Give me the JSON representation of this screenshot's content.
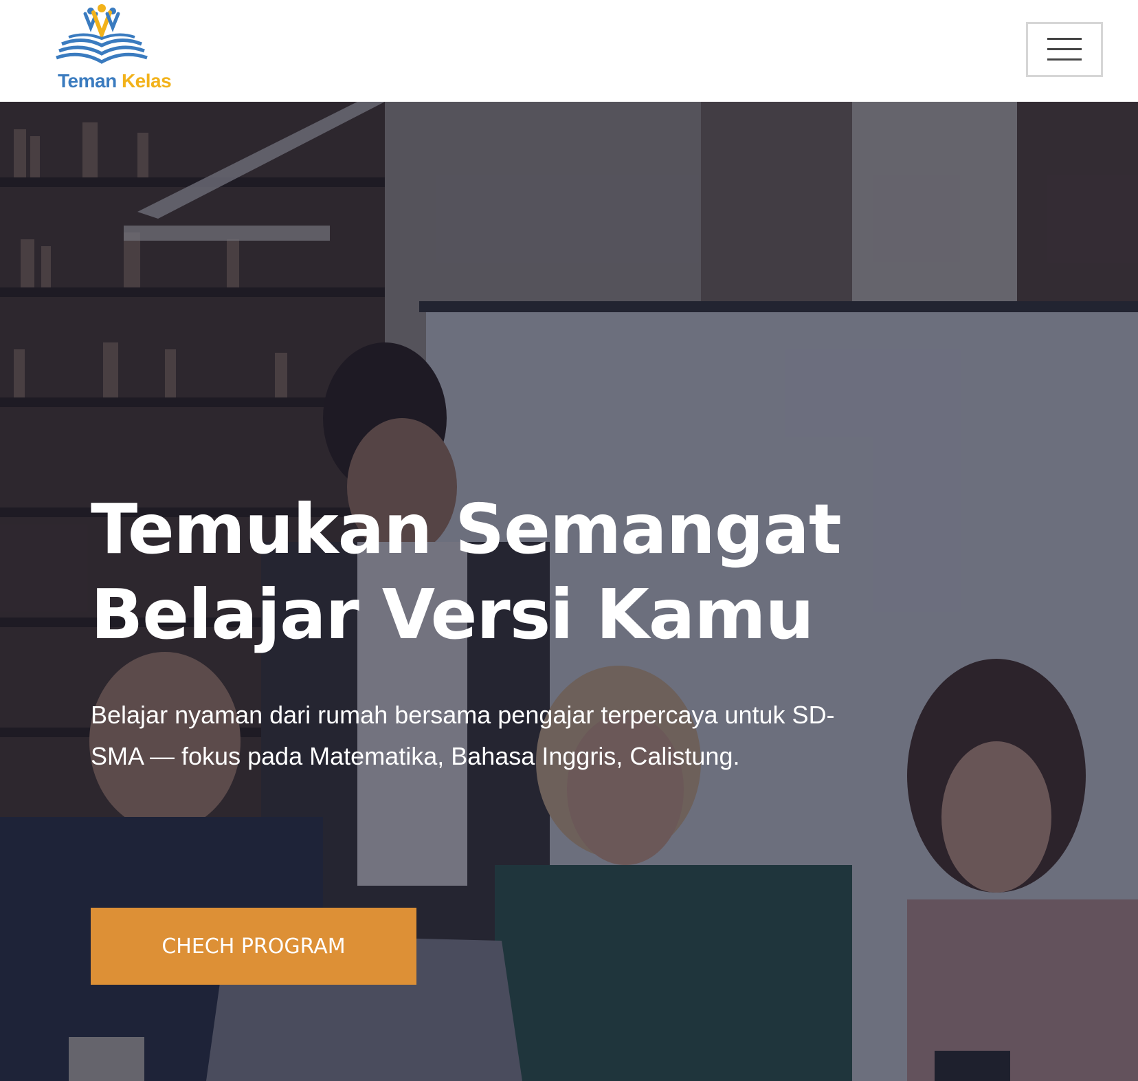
{
  "brand": {
    "name_part1": "Teman",
    "name_part2": "Kelas",
    "colors": {
      "blue": "#3a7bbf",
      "yellow": "#f2b21a"
    }
  },
  "navbar": {
    "menu_icon": "hamburger-menu-icon"
  },
  "hero": {
    "title": "Temukan Semangat Belajar Versi Kamu",
    "subtitle": "Belajar nyaman dari rumah bersama pengajar terpercaya untuk SD-SMA — fokus pada Matematika, Bahasa Inggris, Calistung.",
    "cta_label": "CHECH PROGRAM",
    "cta_color": "#dd9036",
    "background": "photo of students studying together at a laptop in a library"
  }
}
